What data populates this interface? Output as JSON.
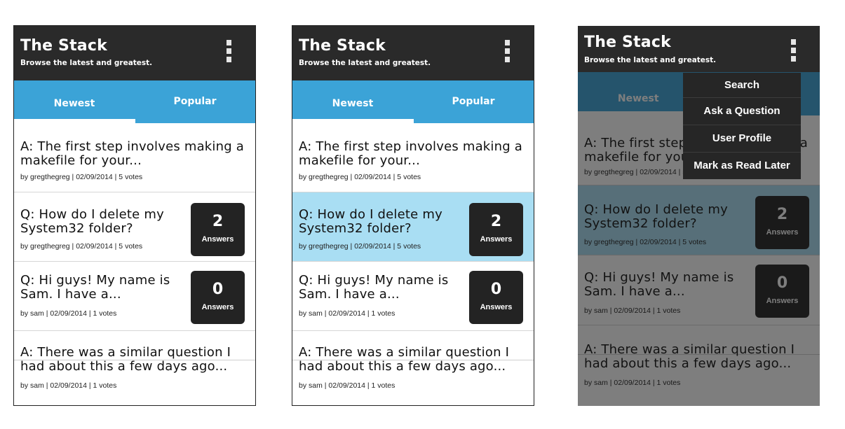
{
  "app": {
    "title": "The Stack",
    "subtitle": "Browse the latest and greatest.",
    "menu_icon": "overflow-menu-icon"
  },
  "tabs": [
    "Newest",
    "Popular"
  ],
  "posts": [
    {
      "text": "A: The first step involves making a makefile for your...",
      "meta": "by gregthegreg | 02/09/2014 | 5 votes"
    },
    {
      "text": "Q: How do I delete my System32 folder?",
      "meta": "by gregthegreg | 02/09/2014 | 5 votes",
      "answers_count": "2",
      "answers_label": "Answers"
    },
    {
      "text": "Q: Hi guys! My name is Sam. I have a...",
      "meta": "by sam | 02/09/2014 | 1 votes",
      "answers_count": "0",
      "answers_label": "Answers"
    },
    {
      "text": "A: There was a similar question I had about this a few days ago...",
      "meta": "by sam | 02/09/2014 | 1 votes"
    }
  ],
  "overflow_menu": [
    "Search",
    "Ask a Question",
    "User Profile",
    "Mark as Read Later"
  ],
  "colors": {
    "app_bar": "#2a2a2a",
    "tab_bar": "#3ba3d7",
    "selected_row": "#a9def3",
    "badge": "#232323"
  }
}
